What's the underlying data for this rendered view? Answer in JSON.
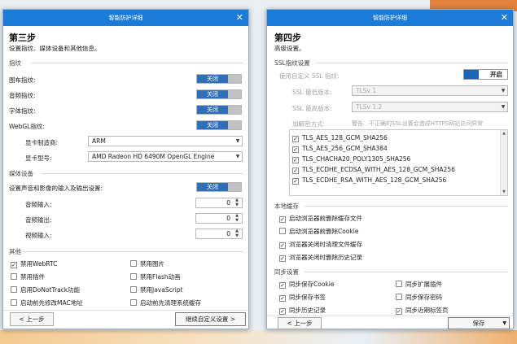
{
  "left": {
    "title": "智能防护详细",
    "step": "第三步",
    "desc": "设置指纹、媒体设备和其他信息。",
    "fingerprint": {
      "heading": "指纹",
      "items": [
        {
          "label": "图布指纹:",
          "toggle": "关闭"
        },
        {
          "label": "音频指纹:",
          "toggle": "关闭"
        },
        {
          "label": "字体指纹:",
          "toggle": "关闭"
        },
        {
          "label": "WebGL指纹:",
          "toggle": "关闭"
        }
      ],
      "vendor_label": "显卡制造商:",
      "vendor_value": "ARM",
      "model_label": "显卡型号:",
      "model_value": "AMD Radeon HD 6490M OpenGL Engine"
    },
    "media": {
      "heading": "媒体设备",
      "policy_label": "设置声音和影像的输入及输出设置:",
      "policy_toggle": "关闭",
      "items": [
        {
          "label": "音频输入:",
          "value": "0"
        },
        {
          "label": "音频输出:",
          "value": "0"
        },
        {
          "label": "视频输入:",
          "value": "0"
        }
      ]
    },
    "other": {
      "heading": "其他",
      "left_items": [
        {
          "label": "禁用WebRTC",
          "checked": true
        },
        {
          "label": "禁用插件",
          "checked": false
        },
        {
          "label": "启用DoNotTrack功能",
          "checked": false
        },
        {
          "label": "启动前先修改MAC地址",
          "checked": false
        }
      ],
      "right_items": [
        {
          "label": "禁用图片",
          "checked": false
        },
        {
          "label": "禁用Flash动画",
          "checked": false
        },
        {
          "label": "禁用JavaScript",
          "checked": false
        },
        {
          "label": "启动前先清理系统缓存",
          "checked": false
        }
      ]
    },
    "prev_button": "< 上一步",
    "next_button": "继续自定义设置 >"
  },
  "right": {
    "title": "智能防护详细",
    "step": "第四步",
    "desc": "高级设置。",
    "ssl": {
      "heading": "SSL指纹设置",
      "custom_label": "使用自定义 SSL 指纹:",
      "on_label": "开启",
      "min_label": "SSL 最低版本:",
      "min_value": "TLSv 1",
      "max_label": "SSL 最高版本:",
      "max_value": "TLSv 1.2",
      "cipher_label": "加解密方式:",
      "cipher_note": "警告：不正确的SSL设置会造成HTTPS网站访问异常",
      "ciphers": [
        {
          "label": "TLS_AES_128_GCM_SHA256",
          "checked": true
        },
        {
          "label": "TLS_AES_256_GCM_SHA384",
          "checked": true
        },
        {
          "label": "TLS_CHACHA20_POLY1305_SHA256",
          "checked": true
        },
        {
          "label": "TLS_ECDHE_ECDSA_WITH_AES_128_GCM_SHA256",
          "checked": true
        },
        {
          "label": "TLS_ECDHE_RSA_WITH_AES_128_GCM_SHA256",
          "checked": true
        }
      ]
    },
    "cache": {
      "heading": "本地缓存",
      "items": [
        {
          "label": "启动浏览器前删除缓存文件",
          "checked": true
        },
        {
          "label": "启动浏览器前删除Cookie",
          "checked": false
        },
        {
          "label": "浏览器关闭时清理文件缓存",
          "checked": true
        },
        {
          "label": "浏览器关闭时删除历史记录",
          "checked": true
        }
      ]
    },
    "sync": {
      "heading": "同步设置",
      "left_items": [
        {
          "label": "同步保存Cookie",
          "checked": true
        },
        {
          "label": "同步保存书签",
          "checked": true
        },
        {
          "label": "同步历史记录",
          "checked": true
        }
      ],
      "right_items": [
        {
          "label": "同步扩展插件",
          "checked": false
        },
        {
          "label": "同步保存密码",
          "checked": false
        },
        {
          "label": "同步近期标签页",
          "checked": true
        }
      ]
    },
    "prev_button": "< 上一步",
    "save_button": "保存"
  },
  "colors": {
    "titlebar": "#1a7bd8",
    "toggle_on": "#2f6fb7"
  }
}
